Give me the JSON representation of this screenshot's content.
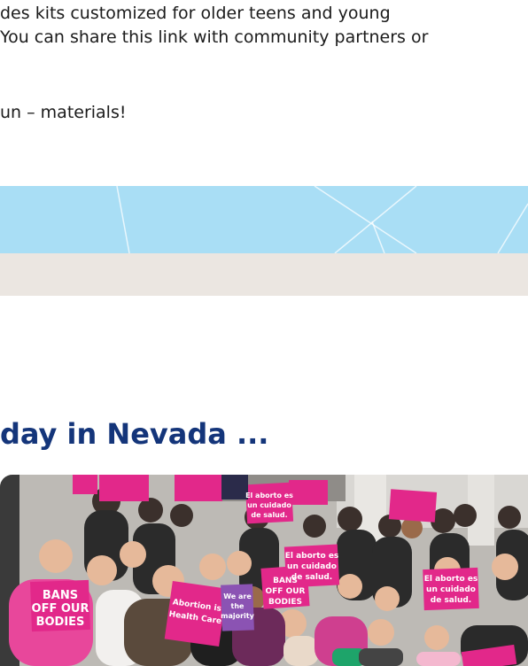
{
  "intro": {
    "line1": "des kits customized for older teens and young",
    "line2": "You can share this link with community partners or",
    "line3": "un – materials!"
  },
  "section": {
    "heading": "day in Nevada ..."
  },
  "photo": {
    "signs": {
      "bans_off_our_bodies": [
        "BANS",
        "OFF OUR",
        "BODIES"
      ],
      "aborto_cuidado": [
        "El aborto es",
        "un cuidado",
        "de salud."
      ],
      "abortion_health_care": [
        "Abortion is",
        "Health Care"
      ],
      "we_are_majority": [
        "We are",
        "the",
        "majority"
      ]
    }
  },
  "colors": {
    "heading": "#14357a",
    "blue_band": "#a9def5",
    "beige_band": "#ebe6e1",
    "sign_pink": "#e2288a"
  }
}
